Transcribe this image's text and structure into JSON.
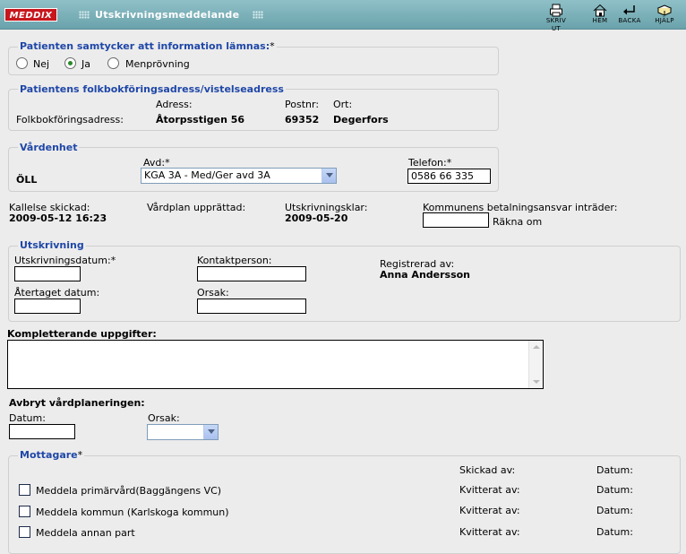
{
  "header": {
    "logo": "MEDDIX",
    "title": "Utskrivningsmeddelande",
    "buttons": [
      {
        "label": "SKRIV UT",
        "icon": "printer-icon"
      },
      {
        "label": "HEM",
        "icon": "home-icon"
      },
      {
        "label": "BACKA",
        "icon": "back-arrow-icon"
      },
      {
        "label": "HJÄLP",
        "icon": "help-book-icon"
      }
    ]
  },
  "consent": {
    "legend": "Patienten samtycker att information lämnas:",
    "required": "*",
    "options": [
      "Nej",
      "Ja",
      "Menprövning"
    ],
    "selected": "Ja"
  },
  "address": {
    "legend": "Patientens folkbokföringsadress/vistelseadress",
    "row_label": "Folkbokföringsadress:",
    "address_label": "Adress:",
    "address_value": "Åtorpsstigen 56",
    "postnr_label": "Postnr:",
    "postnr_value": "69352",
    "ort_label": "Ort:",
    "ort_value": "Degerfors"
  },
  "unit": {
    "legend": "Vårdenhet",
    "unit_value": "ÖLL",
    "avd_label": "Avd:*",
    "avd_value": "KGA 3A - Med/Ger avd 3A",
    "phone_label": "Telefon:*",
    "phone_value": "0586 66 335"
  },
  "status": {
    "kallelse_label": "Kallelse skickad:",
    "kallelse_value": "2009-05-12 16:23",
    "vardplan_label": "Vårdplan upprättad:",
    "klar_label": "Utskrivningsklar:",
    "klar_value": "2009-05-20",
    "kommun_label": "Kommunens betalningsansvar inträder:",
    "kommun_value": "",
    "recalc_label": "Räkna om"
  },
  "discharge": {
    "legend": "Utskrivning",
    "date_label": "Utskrivningsdatum:*",
    "date_value": "",
    "contact_label": "Kontaktperson:",
    "contact_value": "",
    "registered_label": "Registrerad av:",
    "registered_value": "Anna Andersson",
    "retracted_label": "Återtaget datum:",
    "retracted_value": "",
    "reason_label": "Orsak:",
    "reason_value": ""
  },
  "extra": {
    "label": "Kompletterande uppgifter:",
    "value": ""
  },
  "cancel": {
    "label": "Avbryt vårdplaneringen:",
    "date_label": "Datum:",
    "date_value": "",
    "reason_label": "Orsak:",
    "reason_value": ""
  },
  "recipients": {
    "legend": "Mottagare",
    "required": "*",
    "sent_by_label": "Skickad av:",
    "date_label": "Datum:",
    "items": [
      {
        "label": "Meddela primärvård(Baggängens VC)",
        "status_label": "Kvitterat av:",
        "date_label": "Datum:"
      },
      {
        "label": "Meddela kommun (Karlskoga kommun)",
        "status_label": "Kvitterat av:",
        "date_label": "Datum:"
      },
      {
        "label": "Meddela annan part",
        "status_label": "Kvitterat av:",
        "date_label": "Datum:"
      }
    ]
  }
}
